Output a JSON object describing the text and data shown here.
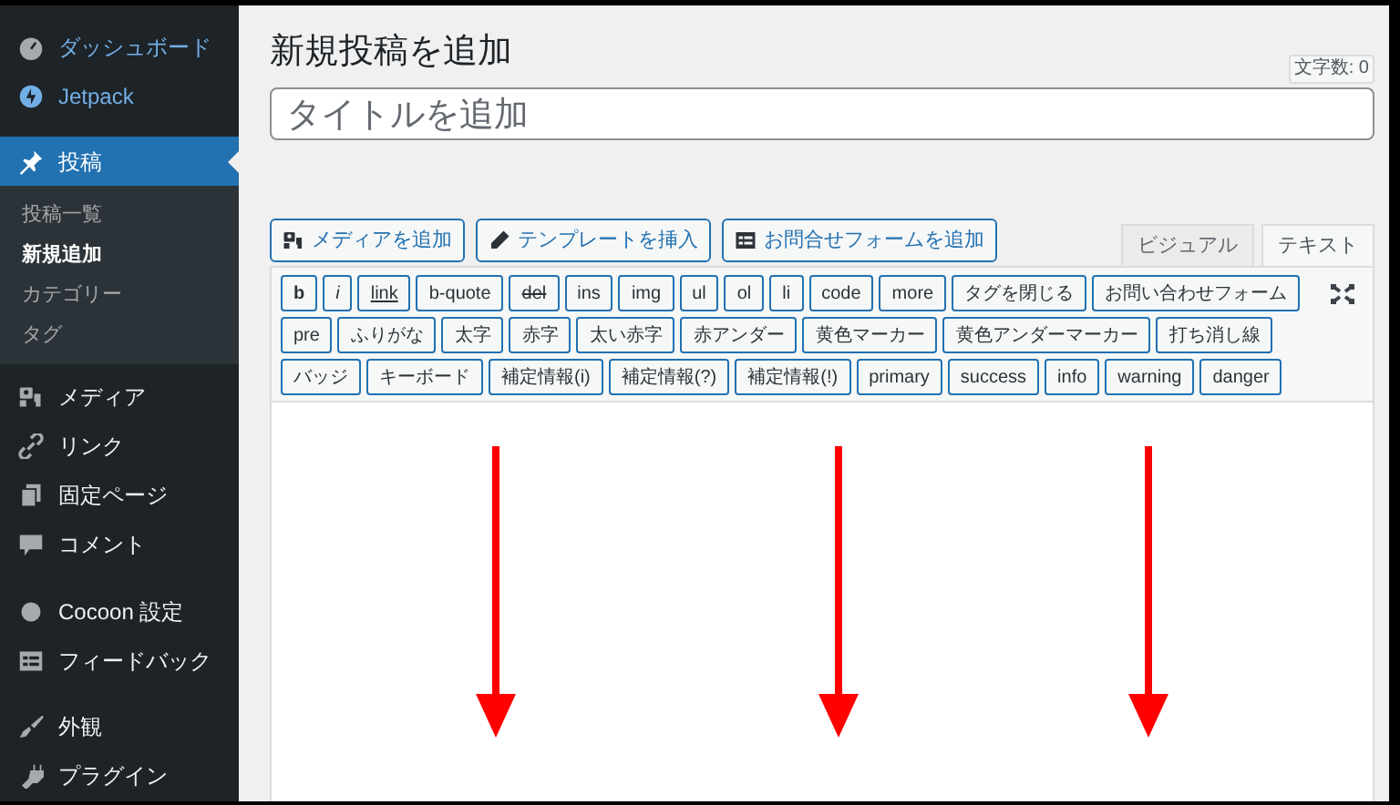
{
  "sidebar": {
    "items": [
      {
        "label": "ダッシュボード",
        "selected": false
      },
      {
        "label": "Jetpack",
        "selected": false
      },
      {
        "label": "投稿",
        "selected": true,
        "children": [
          {
            "label": "投稿一覧",
            "selected": false
          },
          {
            "label": "新規追加",
            "selected": true
          },
          {
            "label": "カテゴリー",
            "selected": false
          },
          {
            "label": "タグ",
            "selected": false
          }
        ]
      },
      {
        "label": "メディア",
        "selected": false
      },
      {
        "label": "リンク",
        "selected": false
      },
      {
        "label": "固定ページ",
        "selected": false
      },
      {
        "label": "コメント",
        "selected": false
      },
      {
        "label": "Cocoon 設定",
        "selected": false
      },
      {
        "label": "フィードバック",
        "selected": false
      },
      {
        "label": "外観",
        "selected": false
      },
      {
        "label": "プラグイン",
        "selected": false
      }
    ]
  },
  "page_title": "新規投稿を追加",
  "char_count": "文字数: 0",
  "title_field": {
    "placeholder": "タイトルを追加"
  },
  "media_buttons": [
    {
      "label": "メディアを追加"
    },
    {
      "label": "テンプレートを挿入"
    },
    {
      "label": "お問合せフォームを追加"
    }
  ],
  "editor_tabs": [
    {
      "label": "ビジュアル",
      "selected": false
    },
    {
      "label": "テキスト",
      "selected": true
    }
  ],
  "quicktag_rows": [
    [
      "b",
      "i",
      "link",
      "b-quote",
      "del",
      "ins",
      "img",
      "ul",
      "ol",
      "li",
      "code",
      "more",
      "タグを閉じる",
      "お問い合わせフォーム"
    ],
    [
      "pre",
      "ふりがな",
      "太字",
      "赤字",
      "太い赤字",
      "赤アンダー",
      "黄色マーカー",
      "黄色アンダーマーカー",
      "打ち消し線"
    ],
    [
      "バッジ",
      "キーボード",
      "補定情報(i)",
      "補定情報(?)",
      "補定情報(!)",
      "primary",
      "success",
      "info",
      "warning",
      "danger"
    ]
  ],
  "annotation_arrows": [
    {
      "kind": "down"
    },
    {
      "kind": "down"
    },
    {
      "kind": "down"
    }
  ]
}
